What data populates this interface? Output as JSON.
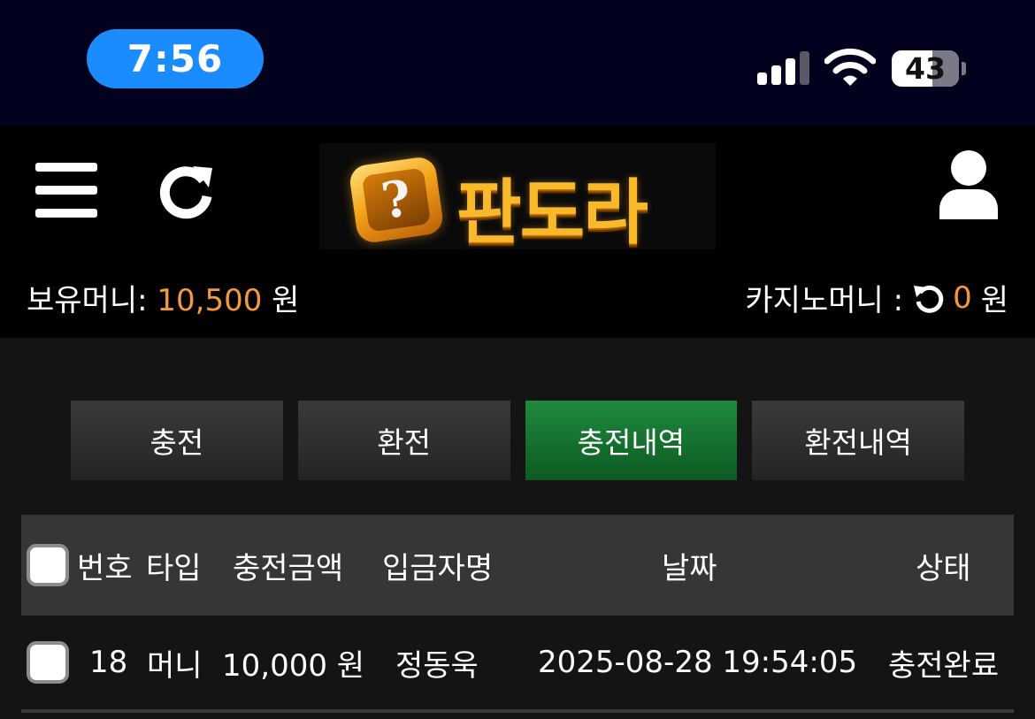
{
  "status_bar": {
    "time": "7:56",
    "battery": "43",
    "signal_bars": 3,
    "icons": [
      "signal-icon",
      "wifi-icon",
      "battery-icon"
    ]
  },
  "header": {
    "logo_text": "판도라",
    "logo_symbol": "?",
    "icons": [
      "hamburger-menu-icon",
      "refresh-icon",
      "user-icon"
    ]
  },
  "balance": {
    "label": "보유머니:",
    "amount": "10,500",
    "unit": "원"
  },
  "casino": {
    "label": "카지노머니 :",
    "amount": "0",
    "unit": "원"
  },
  "tabs": [
    {
      "label": "충전",
      "active": false
    },
    {
      "label": "환전",
      "active": false
    },
    {
      "label": "충전내역",
      "active": true
    },
    {
      "label": "환전내역",
      "active": false
    }
  ],
  "table": {
    "headers": {
      "number": "번호",
      "type": "타입",
      "amount": "충전금액",
      "depositor": "입금자명",
      "date": "날짜",
      "status": "상태"
    },
    "rows": [
      {
        "number": "18",
        "type": "머니",
        "amount": "10,000 원",
        "depositor": "정동욱",
        "date": "2025-08-28 19:54:05",
        "status": "충전완료"
      }
    ]
  },
  "colors": {
    "accent_orange": "#f59a3a",
    "active_tab_green": "#1f8a3e",
    "time_pill_blue": "#1a8cff",
    "status_bar_bg": "#02021e"
  }
}
